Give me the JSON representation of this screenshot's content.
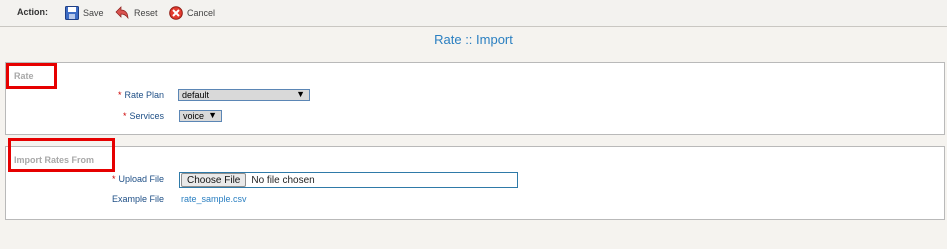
{
  "toolbar": {
    "action_label": "Action:",
    "save_label": "Save",
    "reset_label": "Reset",
    "cancel_label": "Cancel"
  },
  "page": {
    "title": "Rate :: Import"
  },
  "rate_section": {
    "legend": "Rate",
    "rate_plan": {
      "required_mark": "*",
      "label": "Rate Plan",
      "value": "default"
    },
    "services": {
      "required_mark": "*",
      "label": "Services",
      "value": "voice"
    }
  },
  "import_section": {
    "legend": "Import Rates From",
    "upload": {
      "required_mark": "*",
      "label": "Upload File",
      "button": "Choose File",
      "status": "No file chosen"
    },
    "example": {
      "label": "Example File",
      "link": "rate_sample.csv"
    }
  },
  "colors": {
    "accent": "#2a7fc1",
    "label": "#1e4f86",
    "highlight": "#e60000",
    "required": "#cc0000"
  }
}
